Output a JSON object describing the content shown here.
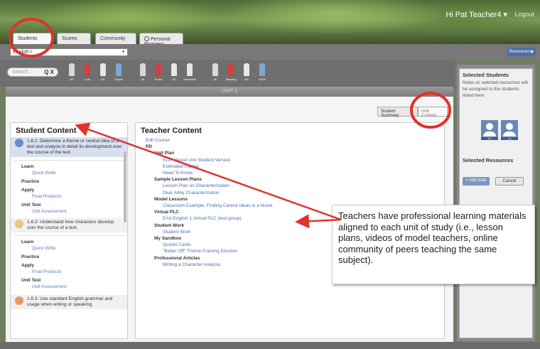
{
  "header": {
    "greeting": "Hi Pat Teacher4 ▾",
    "logout": "Logout",
    "tabs": [
      {
        "label": "Students"
      },
      {
        "label": "Scores"
      },
      {
        "label": "Community"
      },
      {
        "label": "Personal Progress"
      }
    ]
  },
  "toolbar": {
    "course": "English I",
    "course_arrow": "♦",
    "resources_label": "Resources ▶",
    "search_placeholder": "Search...",
    "search_tools": "Q X"
  },
  "filters": [
    {
      "label": "All",
      "color": "#d8d8d8"
    },
    {
      "label": "Lost",
      "color": "#d04040"
    },
    {
      "label": "OK",
      "color": "#e6e6e6"
    },
    {
      "label": "Expert",
      "color": "#7fa6d6"
    },
    {
      "label": "All",
      "color": "#d8d8d8"
    },
    {
      "label": "Bored",
      "color": "#d04040"
    },
    {
      "label": "OK",
      "color": "#e6e6e6"
    },
    {
      "label": "Interested",
      "color": "#e6e6e6"
    },
    {
      "label": "All",
      "color": "#d8d8d8"
    },
    {
      "label": "Slacking",
      "color": "#d04040"
    },
    {
      "label": "OK",
      "color": "#e6e6e6"
    },
    {
      "label": "110%",
      "color": "#7fa6d6"
    }
  ],
  "unit": {
    "title": "UNIT 1",
    "student_summary_label": "Student Summary",
    "unit_content_label": "Unit Content"
  },
  "student_content": {
    "title": "Student Content",
    "objectives": [
      {
        "text": "1.8.1: Determine a theme or central idea of a text and analyze in detail its development over the course of the text.",
        "icon_color": "#6a8cc7",
        "sections": [
          {
            "label": "Learn",
            "link": "Quick Write"
          },
          {
            "label": "Practice",
            "link": ""
          },
          {
            "label": "Apply",
            "link": "Final Products"
          },
          {
            "label": "Unit Test",
            "link": "Unit Assessment"
          }
        ]
      },
      {
        "text": "1.8.2: Understand how characters develop over the course of a text.",
        "icon_color": "#e8c77a",
        "sections": [
          {
            "label": "Learn",
            "link": "Quick Write"
          },
          {
            "label": "Practice",
            "link": ""
          },
          {
            "label": "Apply",
            "link": "Final Products"
          },
          {
            "label": "Unit Test",
            "link": "Unit Assessment"
          }
        ]
      },
      {
        "text": "1.8.3: Use standard English grammar and usage when writing or speaking.",
        "icon_color": "#e79a6a",
        "sections": []
      }
    ]
  },
  "teacher_content": {
    "title": "Teacher Content",
    "lines": [
      {
        "text": "Edit Course",
        "kind": "link",
        "indent": 0
      },
      {
        "text": "PD",
        "kind": "head",
        "indent": 0
      },
      {
        "text": "Unit Plan",
        "kind": "head",
        "indent": 12
      },
      {
        "text": "ELA - Novel Unit Student Version",
        "kind": "link",
        "indent": 24
      },
      {
        "text": "Estimated Pacing",
        "kind": "link",
        "indent": 24
      },
      {
        "text": "Need To Know",
        "kind": "link",
        "indent": 24
      },
      {
        "text": "Sample Lesson Plans",
        "kind": "head",
        "indent": 12
      },
      {
        "text": "Lesson Plan on Characterization",
        "kind": "link",
        "indent": 24
      },
      {
        "text": "Dear Abby Characterization",
        "kind": "link",
        "indent": 24
      },
      {
        "text": "Model Lessons",
        "kind": "head",
        "indent": 12
      },
      {
        "text": "Classroom Example: Finding Central Ideas in a Novel",
        "kind": "link",
        "indent": 24
      },
      {
        "text": "Virtual PLC",
        "kind": "head",
        "indent": 12
      },
      {
        "text": "EAA English 1 Virtual PLC (test group)",
        "kind": "link",
        "indent": 24
      },
      {
        "text": "Student Work",
        "kind": "head",
        "indent": 12
      },
      {
        "text": "Student Work",
        "kind": "link",
        "indent": 24
      },
      {
        "text": "My Sandbox",
        "kind": "head",
        "indent": 12
      },
      {
        "text": "Quizlet Cards",
        "kind": "link",
        "indent": 24
      },
      {
        "text": "\"Better Off\" Theme Framing Election",
        "kind": "link",
        "indent": 24
      },
      {
        "text": "Professional Articles",
        "kind": "head",
        "indent": 12
      },
      {
        "text": "Writing a Character Analysis",
        "kind": "link",
        "indent": 24
      }
    ]
  },
  "sidebar": {
    "selected_students_title": "Selected Students",
    "selected_students_note": "Notes or selected resources will be assigned to the students listed here:",
    "students": [
      {
        "tag": "Stu"
      },
      {
        "tag": "Stu"
      }
    ],
    "selected_resources_title": "Selected Resources",
    "add_note_label": "+ Add Note",
    "cancel_label": "Cancel"
  },
  "callout": {
    "text": "Teachers have professional learning materials aligned to each unit of study (i.e., lesson plans, videos of model teachers, online community of peers teaching the same subject)."
  },
  "annotation_color": "#e0322a"
}
